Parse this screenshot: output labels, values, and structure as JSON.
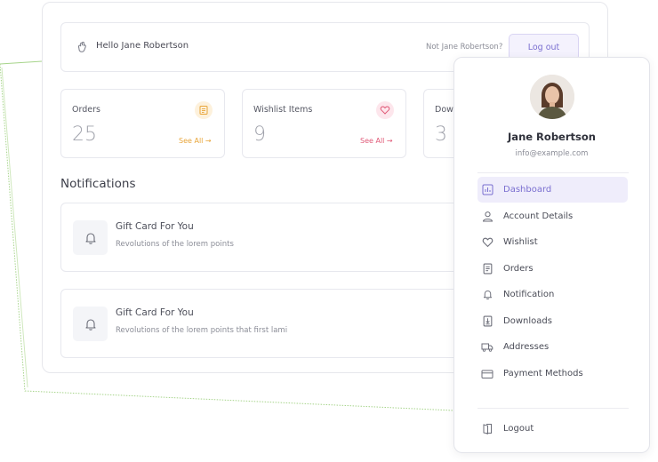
{
  "greeting": {
    "hello_text": "Hello Jane Robertson",
    "not_user_text": "Not Jane Robertson?",
    "logout_label": "Log out"
  },
  "stats": [
    {
      "label": "Orders",
      "value": "25",
      "see_all": "See All →",
      "icon": "orders-icon",
      "color": "#e8a53a",
      "bg": "#fdf1dc"
    },
    {
      "label": "Wishlist Items",
      "value": "9",
      "see_all": "See All →",
      "icon": "heart-icon",
      "color": "#e05a78",
      "bg": "#fde6ec"
    },
    {
      "label": "Dow",
      "value": "3",
      "icon": "downloads-icon"
    }
  ],
  "notifications": {
    "title": "Notifications",
    "items": [
      {
        "title": "Gift Card For You",
        "description": "Revolutions of the lorem points"
      },
      {
        "title": "Gift Card For You",
        "description": "Revolutions of the lorem points that first lami"
      }
    ]
  },
  "user": {
    "name": "Jane Robertson",
    "email": "info@example.com"
  },
  "sidebar": {
    "items": [
      {
        "label": "Dashboard",
        "icon": "dashboard-icon",
        "active": true
      },
      {
        "label": "Account Details",
        "icon": "user-icon",
        "active": false
      },
      {
        "label": "Wishlist",
        "icon": "heart-icon",
        "active": false
      },
      {
        "label": "Orders",
        "icon": "orders-icon",
        "active": false
      },
      {
        "label": "Notification",
        "icon": "bell-icon",
        "active": false
      },
      {
        "label": "Downloads",
        "icon": "download-icon",
        "active": false
      },
      {
        "label": "Addresses",
        "icon": "truck-icon",
        "active": false
      },
      {
        "label": "Payment Methods",
        "icon": "card-icon",
        "active": false
      }
    ],
    "logout_label": "Logout"
  },
  "colors": {
    "accent": "#7a6fd0",
    "accent_bg": "#efedfb",
    "decor_line": "#9fcf7a"
  }
}
